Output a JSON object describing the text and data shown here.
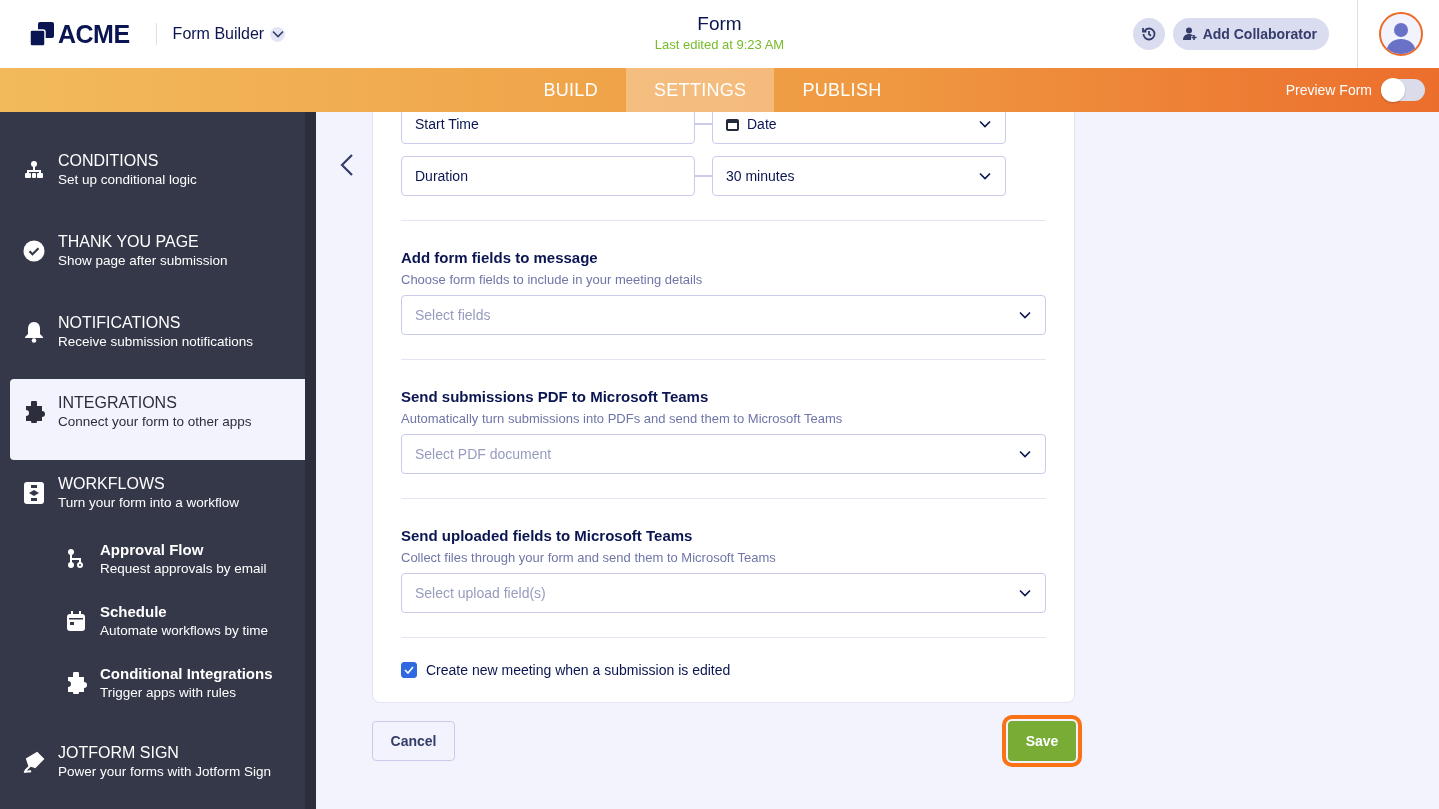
{
  "header": {
    "logo": "ACME",
    "app_menu": "Form Builder",
    "title": "Form",
    "subtitle": "Last edited at 9:23 AM",
    "collaborator_button": "Add Collaborator"
  },
  "tabs": [
    {
      "label": "BUILD",
      "selected": false
    },
    {
      "label": "SETTINGS",
      "selected": true
    },
    {
      "label": "PUBLISH",
      "selected": false
    }
  ],
  "preview": {
    "label": "Preview Form",
    "on": false
  },
  "sidebar": {
    "items": [
      {
        "title": "CONDITIONS",
        "description": "Set up conditional logic",
        "selected": false
      },
      {
        "title": "THANK YOU PAGE",
        "description": "Show page after submission",
        "selected": false
      },
      {
        "title": "NOTIFICATIONS",
        "description": "Receive submission notifications",
        "selected": false
      },
      {
        "title": "INTEGRATIONS",
        "description": "Connect your form to other apps",
        "selected": true
      },
      {
        "title": "WORKFLOWS",
        "description": "Turn your form into a workflow",
        "selected": false,
        "children": [
          {
            "title": "Approval Flow",
            "description": "Request approvals by email",
            "selected": false
          },
          {
            "title": "Schedule",
            "description": "Automate workflows by time",
            "selected": false
          },
          {
            "title": "Conditional Integrations",
            "description": "Trigger apps with rules",
            "selected": false
          }
        ]
      },
      {
        "title": "JOTFORM SIGN",
        "description": "Power your forms with Jotform Sign",
        "selected": false
      }
    ]
  },
  "form": {
    "rows": [
      {
        "label": "Start Time",
        "select": "Date",
        "kind": "date"
      },
      {
        "label": "Duration",
        "select": "30 minutes",
        "kind": "plain"
      }
    ],
    "sections": [
      {
        "title": "Add form fields to message",
        "description": "Choose form fields to include in your meeting details",
        "placeholder": "Select fields"
      },
      {
        "title": "Send submissions PDF to Microsoft Teams",
        "description": "Automatically turn submissions into PDFs and send them to Microsoft Teams",
        "placeholder": "Select PDF document"
      },
      {
        "title": "Send uploaded fields to Microsoft Teams",
        "description": "Collect files through your form and send them to Microsoft Teams",
        "placeholder": "Select upload field(s)"
      }
    ],
    "checkbox": {
      "label": "Create new meeting when a submission is edited",
      "checked": true
    }
  },
  "buttons": {
    "cancel": "Cancel",
    "save": "Save",
    "save_focused": true
  }
}
